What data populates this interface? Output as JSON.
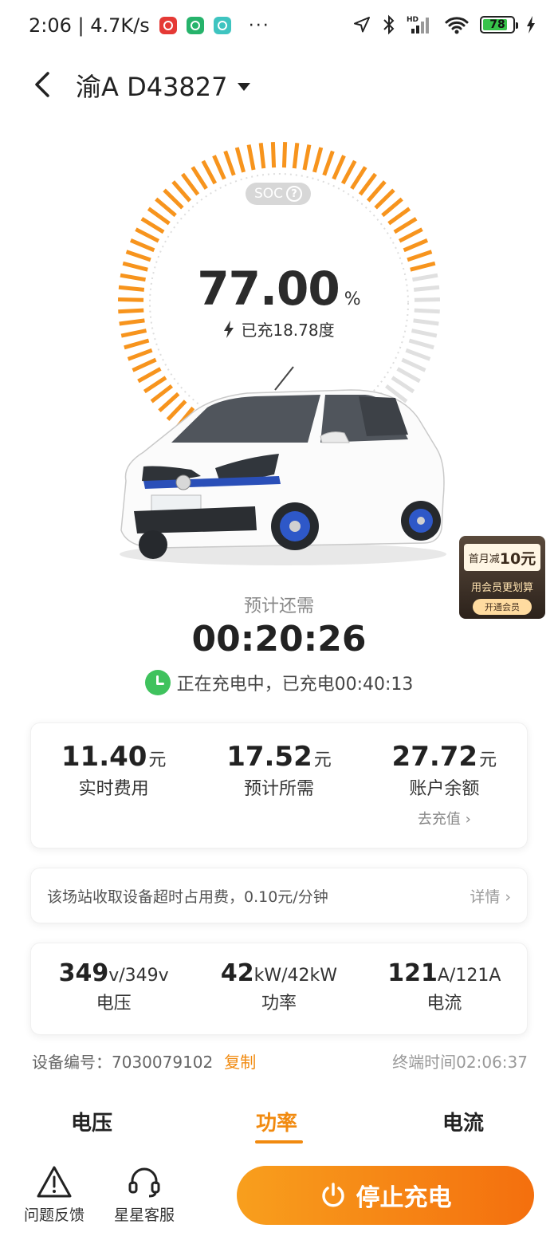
{
  "status_bar": {
    "time_speed": "2:06 | 4.7K/s",
    "dots": "···",
    "battery": "78",
    "hd_label": "HD"
  },
  "header": {
    "plate": "渝A D43827"
  },
  "gauge": {
    "soc_label": "SOC",
    "soc_value": "77.00",
    "percent_sign": "%",
    "charged_text": "已充18.78度",
    "soc_fraction": 0.77,
    "active_color": "#f7941d",
    "inactive_color": "#e0e0e0"
  },
  "promo": {
    "prefix": "首月减",
    "amount": "10元",
    "line2": "用会员更划算",
    "cta": "开通会员"
  },
  "remaining": {
    "label": "预计还需",
    "time": "00:20:26",
    "status": "正在充电中，已充电00:40:13"
  },
  "fees": [
    {
      "amount": "11.40",
      "unit": "元",
      "label": "实时费用"
    },
    {
      "amount": "17.52",
      "unit": "元",
      "label": "预计所需"
    },
    {
      "amount": "27.72",
      "unit": "元",
      "label": "账户余额"
    }
  ],
  "topup": "去充值 ›",
  "notice": {
    "text": "该场站收取设备超时占用费，0.10元/分钟",
    "more": "详情 ›"
  },
  "metrics": [
    {
      "value": "349",
      "unit": "v/349v",
      "label": "电压"
    },
    {
      "value": "42",
      "unit": "kW/42kW",
      "label": "功率"
    },
    {
      "value": "121",
      "unit": "A/121A",
      "label": "电流"
    }
  ],
  "device": {
    "number": "设备编号：7030079102",
    "copy": "复制",
    "terminal_time": "终端时间02:06:37"
  },
  "tabs": {
    "voltage": "电压",
    "power": "功率",
    "current": "电流",
    "active": "功率"
  },
  "bottom": {
    "feedback": "问题反馈",
    "service": "星星客服",
    "stop": "停止充电"
  },
  "colors": {
    "accent": "#f18a0f",
    "green": "#3fc25d"
  }
}
